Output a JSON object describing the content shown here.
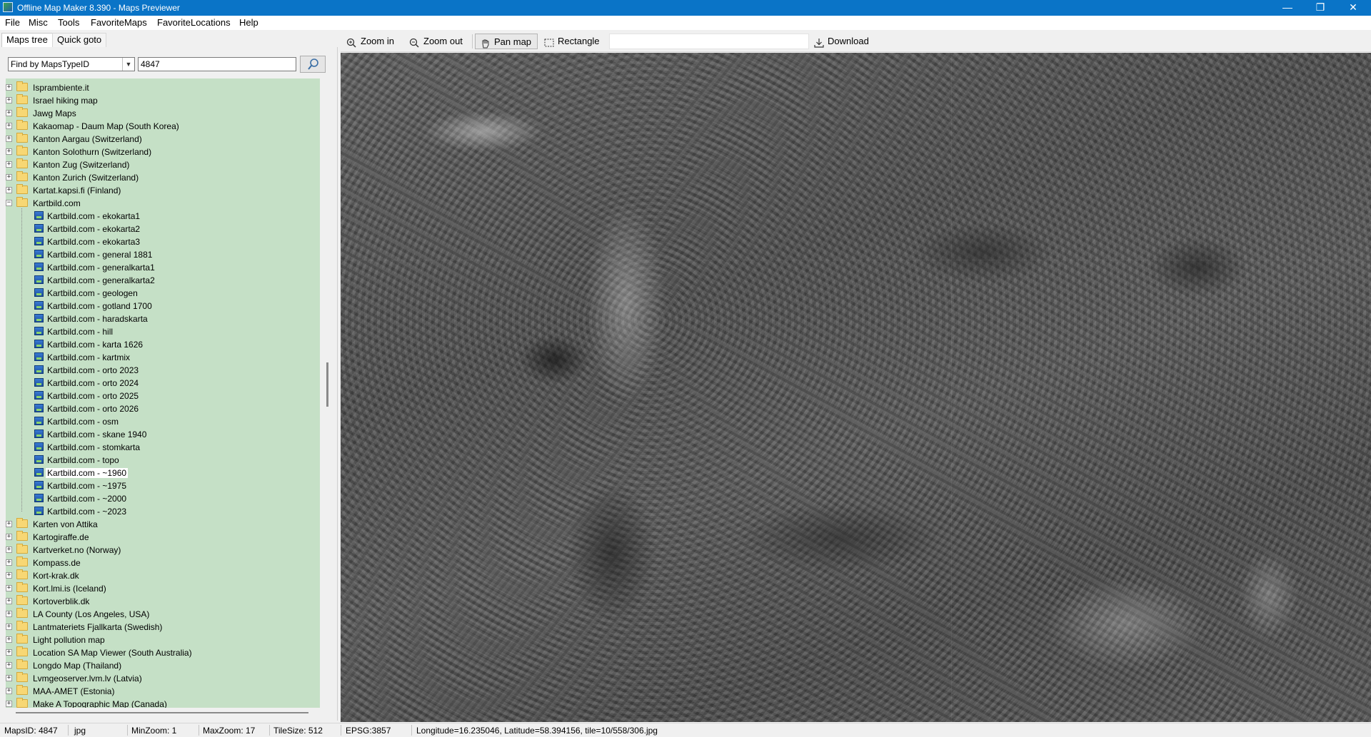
{
  "window": {
    "title": "Offline Map Maker 8.390 - Maps Previewer",
    "controls": {
      "minimize": "—",
      "maximize": "❐",
      "close": "✕"
    }
  },
  "menu": [
    "File",
    "Misc",
    "Tools",
    "FavoriteMaps",
    "FavoriteLocations",
    "Help"
  ],
  "left_tabs": {
    "maps_tree": "Maps tree",
    "quick_goto": "Quick goto",
    "active": "maps_tree"
  },
  "search": {
    "mode": "Find by MapsTypeID",
    "value": "4847",
    "button_icon": "magnifier-icon"
  },
  "tree": {
    "folders_before": [
      "Isprambiente.it",
      "Israel hiking map",
      "Jawg Maps",
      "Kakaomap - Daum Map (South Korea)",
      "Kanton Aargau (Switzerland)",
      "Kanton Solothurn (Switzerland)",
      "Kanton Zug (Switzerland)",
      "Kanton Zurich (Switzerland)",
      "Kartat.kapsi.fi (Finland)"
    ],
    "expanded_folder": "Kartbild.com",
    "expanded_items": [
      "Kartbild.com - ekokarta1",
      "Kartbild.com - ekokarta2",
      "Kartbild.com - ekokarta3",
      "Kartbild.com - general 1881",
      "Kartbild.com - generalkarta1",
      "Kartbild.com - generalkarta2",
      "Kartbild.com - geologen",
      "Kartbild.com - gotland 1700",
      "Kartbild.com - haradskarta",
      "Kartbild.com - hill",
      "Kartbild.com - karta 1626",
      "Kartbild.com - kartmix",
      "Kartbild.com - orto 2023",
      "Kartbild.com - orto 2024",
      "Kartbild.com - orto 2025",
      "Kartbild.com - orto 2026",
      "Kartbild.com - osm",
      "Kartbild.com - skane 1940",
      "Kartbild.com - stomkarta",
      "Kartbild.com - topo",
      "Kartbild.com - ~1960",
      "Kartbild.com - ~1975",
      "Kartbild.com - ~2000",
      "Kartbild.com - ~2023"
    ],
    "selected_item": "Kartbild.com - ~1960",
    "folders_after": [
      "Karten von Attika",
      "Kartogiraffe.de",
      "Kartverket.no (Norway)",
      "Kompass.de",
      "Kort-krak.dk",
      "Kort.lmi.is (Iceland)",
      "Kortoverblik.dk",
      "LA County (Los Angeles, USA)",
      "Lantmateriets Fjallkarta (Swedish)",
      "Light pollution map",
      "Location SA Map Viewer (South Australia)",
      "Longdo Map (Thailand)",
      "Lvmgeoserver.lvm.lv (Latvia)",
      "MAA-AMET (Estonia)",
      "Make A Topographic Map (Canada)"
    ],
    "background_color": "#c5e0c6"
  },
  "toolbar": {
    "zoom_in": "Zoom in",
    "zoom_out": "Zoom out",
    "pan_map": "Pan map",
    "rectangle": "Rectangle",
    "download": "Download",
    "active_tool": "Pan map"
  },
  "status": {
    "maps_id": "MapsID: 4847",
    "format": "jpg",
    "min_zoom": "MinZoom: 1",
    "max_zoom": "MaxZoom: 17",
    "tile_size": "TileSize: 512",
    "epsg": "EPSG:3857",
    "position": "Longitude=16.235046, Latitude=58.394156, tile=10/558/306.jpg"
  },
  "colors": {
    "titlebar": "#0a74c7",
    "tree_bg": "#c5e0c6"
  }
}
